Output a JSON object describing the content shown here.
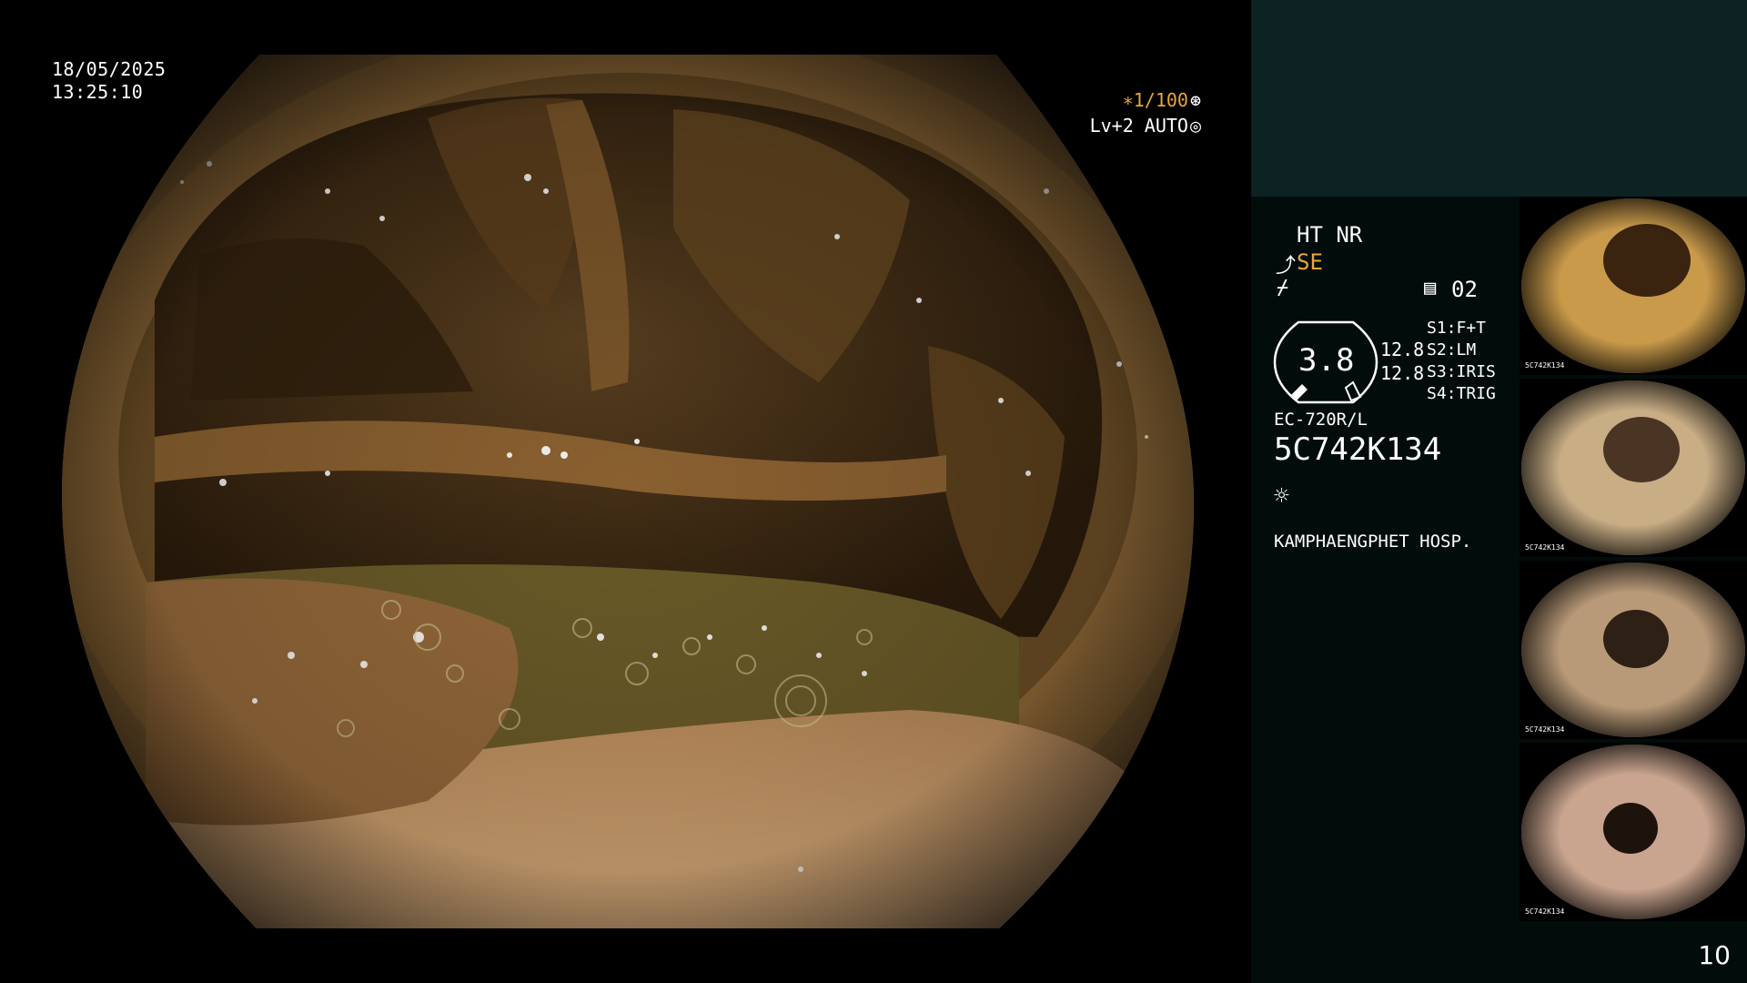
{
  "overlay": {
    "date": "18/05/2025",
    "time": "13:25:10",
    "shutter": "∗1/100",
    "shutter_icon": "shutter-icon",
    "level": "Lv+2 AUTO",
    "level_icon": "auto-iris-icon"
  },
  "status": {
    "mode": "HT NR",
    "se": "SE",
    "se_color": "#e8a73a",
    "memory_label": "02",
    "zoom_value": "3.8",
    "values": [
      "12.8",
      "12.8"
    ],
    "scopes": [
      "S1:F+T",
      "S2:LM",
      "S3:IRIS",
      "S4:TRIG"
    ],
    "model": "EC-720R/L",
    "serial": "5C742K134",
    "hospital": "KAMPHAENGPHET HOSP."
  },
  "thumbnails": [
    {
      "name": "capture-1",
      "caption": "5C742K134",
      "tone": "#c99a4a",
      "lumen": "#3a2410"
    },
    {
      "name": "capture-2",
      "caption": "5C742K134",
      "tone": "#c8ad85",
      "lumen": "#4a3424"
    },
    {
      "name": "capture-3",
      "caption": "5C742K134",
      "tone": "#b99a78",
      "lumen": "#2e2014"
    },
    {
      "name": "capture-4",
      "caption": "5C742K134",
      "tone": "#c9a48e",
      "lumen": "#1e120c"
    }
  ],
  "page_number": "10"
}
